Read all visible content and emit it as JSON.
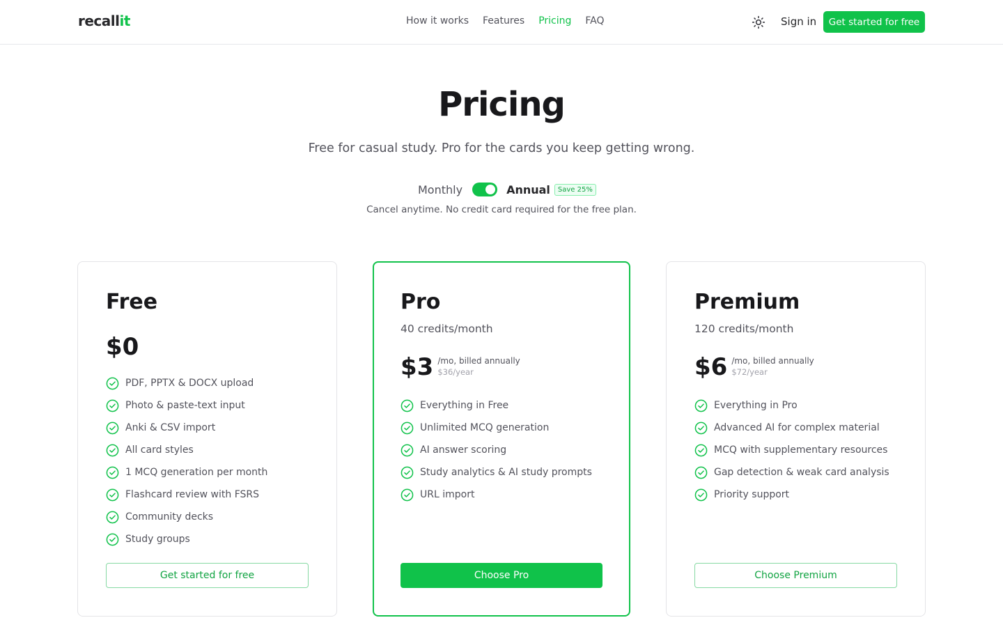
{
  "header": {
    "logo_main": "recall",
    "logo_accent": "it",
    "nav": [
      {
        "label": "How it works"
      },
      {
        "label": "Features"
      },
      {
        "label": "Pricing",
        "active": true
      },
      {
        "label": "FAQ"
      }
    ],
    "theme_icon": "sun-icon",
    "signin_label": "Sign in",
    "cta_label": "Get started for free"
  },
  "hero": {
    "title": "Pricing",
    "subtitle": "Free for casual study. Pro for the cards you keep getting wrong.",
    "billing": {
      "monthly_label": "Monthly",
      "annual_label": "Annual",
      "save_badge": "Save 25%",
      "selected": "Annual"
    },
    "note": "Cancel anytime. No credit card required for the free plan."
  },
  "plans": [
    {
      "name": "Free",
      "credits": "",
      "price": "$0",
      "billed": "",
      "yearly": "",
      "features": [
        "PDF, PPTX & DOCX upload",
        "Photo & paste-text input",
        "Anki & CSV import",
        "All card styles",
        "1 MCQ generation per month",
        "Flashcard review with FSRS",
        "Community decks",
        "Study groups"
      ],
      "button_label": "Get started for free"
    },
    {
      "name": "Pro",
      "credits": "40 credits/month",
      "price": "$3",
      "billed": "/mo, billed annually",
      "yearly": "$36/year",
      "features": [
        "Everything in Free",
        "Unlimited MCQ generation",
        "AI answer scoring",
        "Study analytics & AI study prompts",
        "URL import"
      ],
      "button_label": "Choose Pro"
    },
    {
      "name": "Premium",
      "credits": "120 credits/month",
      "price": "$6",
      "billed": "/mo, billed annually",
      "yearly": "$72/year",
      "features": [
        "Everything in Pro",
        "Advanced AI for complex material",
        "MCQ with supplementary resources",
        "Gap detection & weak card analysis",
        "Priority support"
      ],
      "button_label": "Choose Premium"
    }
  ],
  "colors": {
    "accent": "#10c24a",
    "text": "#18181b",
    "muted": "#52525b"
  }
}
